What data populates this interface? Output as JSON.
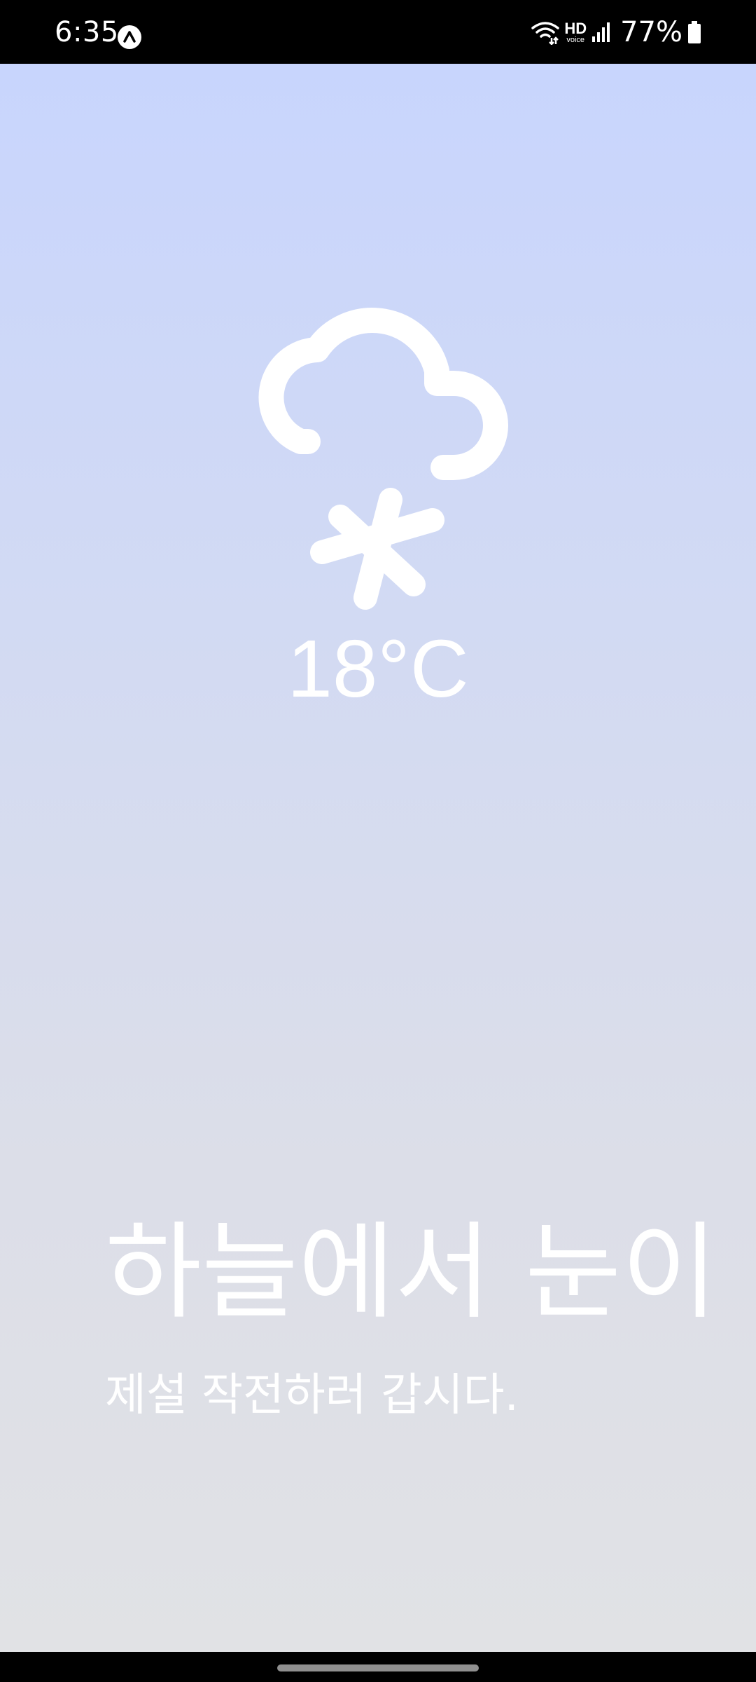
{
  "status_bar": {
    "time": "6:35",
    "network_label": "HD",
    "network_sub": "voice",
    "battery_percent": "77%"
  },
  "weather": {
    "icon": "cloud-snow-icon",
    "temperature": "18°C"
  },
  "message": {
    "headline": "하늘에서 눈이",
    "subline": "제설 작전하러 갑시다."
  },
  "colors": {
    "gradient_top": "#c8d5fd",
    "gradient_bottom": "#e1e2e5",
    "text": "#ffffff"
  }
}
